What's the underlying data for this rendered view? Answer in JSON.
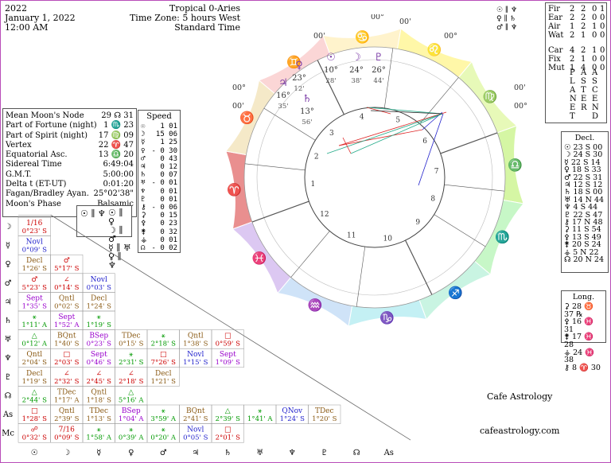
{
  "header": {
    "year": "2022",
    "date": "January 1, 2022",
    "time": "12:00 AM",
    "zodiac": "Tropical 0-Aries",
    "timezone": "Time Zone: 5 hours West",
    "standard": "Standard Time"
  },
  "points": [
    {
      "k": "Mean Moon's Node",
      "v": "29 ☊ 31"
    },
    {
      "k": "Part of Fortune (night)",
      "v": "1 ♏ 23"
    },
    {
      "k": "Part of Spirit (night)",
      "v": "17 ♍ 09"
    },
    {
      "k": "Vertex",
      "v": "22 ♈ 47"
    },
    {
      "k": "Equatorial Asc.",
      "v": "13 ♎ 20"
    },
    {
      "k": "Sidereal Time",
      "v": "6:49:04"
    },
    {
      "k": "G.M.T.",
      "v": "5:00:00"
    },
    {
      "k": "Delta t (ET-UT)",
      "v": "0:01:20"
    },
    {
      "k": "Fagan/Bradley Ayan.",
      "v": "25°02'38\""
    },
    {
      "k": "Moon's Phase",
      "v": "Balsamic"
    }
  ],
  "speed": {
    "title": "Speed",
    "rows": [
      {
        "g": "☉",
        "v": "1 01"
      },
      {
        "g": "☽",
        "v": "15 06"
      },
      {
        "g": "☿",
        "v": "1 25"
      },
      {
        "g": "♀",
        "v": "- 0 30"
      },
      {
        "g": "♂",
        "v": "0 43"
      },
      {
        "g": "♃",
        "v": "0 12"
      },
      {
        "g": "♄",
        "v": "0 07"
      },
      {
        "g": "♅",
        "v": "- 0 01"
      },
      {
        "g": "♆",
        "v": "0 01"
      },
      {
        "g": "♇",
        "v": "0 01"
      },
      {
        "g": "⚷",
        "v": "- 0 06"
      },
      {
        "g": "⚳",
        "v": "0 15"
      },
      {
        "g": "⚴",
        "v": "0 23"
      },
      {
        "g": "⚵",
        "v": "0 32"
      },
      {
        "g": "⚶",
        "v": "0 01"
      },
      {
        "g": "☊",
        "v": "- 0 02"
      }
    ]
  },
  "elements": {
    "labels": [
      "Fir",
      "Ear",
      "Air",
      "Wat",
      "Car",
      "Fix",
      "Mut"
    ],
    "col1": [
      "2",
      "2",
      "1",
      "2",
      "4",
      "2",
      "1"
    ],
    "col2": [
      "2",
      "2",
      "2",
      "1",
      "2",
      "1",
      "4"
    ],
    "col3": [
      "0",
      "0",
      "1",
      "0",
      "1",
      "0",
      "0"
    ],
    "col4": [
      "1",
      "0",
      "0",
      "0",
      "0",
      "0",
      "0"
    ],
    "vert1": [
      "P",
      "L",
      "A",
      "N",
      "E",
      "T"
    ],
    "vert2": [
      "A",
      "S",
      "T",
      "E",
      "R"
    ],
    "vert3": [
      "A",
      "S",
      "C",
      "E",
      "N",
      "D"
    ]
  },
  "top_parallels": [
    "☉ ∥ ♆",
    "♀ ∥ ♄",
    "♂ ∥ ♆"
  ],
  "mid_parallels": [
    "☉ ∥ ♀",
    "☽ ∥ ♂",
    "☿ ∥ ♅",
    "♀ ∥ ♆"
  ],
  "moon_parallel": "☉ ∥ ♆",
  "declinations": {
    "title": "Decl.",
    "rows": [
      "☉ 23 S 00",
      "☽ 24 S 30",
      "☿ 22 S 14",
      "♀ 18 S 33",
      "♂ 22 S 31",
      "♃ 12 S 12",
      "♄ 18 S 00",
      "♅ 14 N 44",
      "♆ 4 S 44",
      "♇ 22 S 47",
      "⚷ 17 N 48",
      "⚳ 11 S 54",
      "⚴ 13 S 49",
      "⚵ 20 S 24",
      "⚶ 5 N 22",
      "☊ 20 N 24"
    ]
  },
  "longitudes": {
    "title": "Long.",
    "rows": [
      "⚳ 28 ♉ 37 ℞",
      "⚴ 16 ♓ 31",
      "⚵ 17 ♓ 28",
      "⚶ 24 ♓ 38",
      "⚷ 8 ♈ 30"
    ]
  },
  "credits": {
    "name": "Cafe Astrology",
    "site": "cafeastrology.com"
  },
  "colors": {
    "aries": "#e6a0a0",
    "taurus": "#e0d2b4",
    "gemini": "#ffdcdc",
    "cancer": "#fff6d6"
  },
  "wheel": {
    "angles": [
      "9",
      "10",
      "11",
      "12",
      "1",
      "2",
      "3",
      "4",
      "5",
      "6",
      "7",
      "8"
    ],
    "outer_degrees": [
      "00°",
      "00'",
      "00'",
      "00°",
      "00°",
      "00'",
      "00'",
      "00°"
    ],
    "planets": [
      {
        "glyph": "☉",
        "deg": "10°",
        "min": "28'"
      },
      {
        "glyph": "☽",
        "deg": "24°",
        "min": "38'"
      },
      {
        "glyph": "♇",
        "deg": "26°",
        "min": "44'"
      },
      {
        "glyph": "♀",
        "deg": "23°",
        "min": "12'"
      },
      {
        "glyph": "♃",
        "deg": "16°",
        "min": "35'"
      },
      {
        "glyph": "♄",
        "deg": "13°",
        "min": "56'"
      }
    ]
  },
  "aspect_grid": {
    "row_labels": [
      "☽",
      "☿",
      "♀",
      "♂",
      "♃",
      "♄",
      "♅",
      "♆",
      "♇",
      "☊",
      "As",
      "Mc"
    ],
    "col_labels": [
      "☉",
      "☽",
      "☿",
      "♀",
      "♂",
      "♃",
      "♄",
      "♅",
      "♆",
      "♇",
      "☊",
      "As"
    ],
    "cells": [
      [
        "1/16\n0°23' S"
      ],
      [
        "Novl\n0°09' S"
      ],
      [
        "Decl\n1°26' S",
        "♂\n5°17' S"
      ],
      [
        "♂\n5°23' S",
        "∠\n0°14' S",
        "Novl\n0°03' S"
      ],
      [
        "Sept\n1°35' S",
        "Qntl\n0°02' S",
        "Decl\n1°24' S"
      ],
      [
        "⚹\n1°11' A",
        "Sept\n1°52' A",
        "⚹\n1°19' S"
      ],
      [
        "△\n0°12' A",
        "BQnt\n1°40' S",
        "BSep\n0°23' S",
        "TDec\n0°15' S",
        "⚹\n2°18' S",
        "Qntl\n1°38' S",
        "□\n0°59' S"
      ],
      [
        "Qntl\n2°04' S",
        "□\n2°03' S",
        "Sept\n0°46' S",
        "⚹\n2°31' S",
        "□\n7°26' S",
        "Novl\n1°15' S",
        "Sept\n1°09' S"
      ],
      [
        "Decl\n1°19' S",
        "∠\n2°32' S",
        "∠\n2°45' S",
        "∠\n2°18' S",
        "Decl\n1°21' S"
      ],
      [
        "△\n2°44' S",
        "TDec\n1°17' A",
        "Qntl\n1°18' S",
        "△\n5°16' A"
      ],
      [
        "□\n1°28' S",
        "Qntl\n2°39' S",
        "TDec\n1°13' S",
        "BSep\n1°04' A",
        "⚹\n3°59' A",
        "BQnt\n2°41' S",
        "△\n2°39' S",
        "⚹\n1°41' A",
        "QNov\n1°24' S",
        "TDec\n1°20' S"
      ],
      [
        "☍\n0°32' S",
        "7/16\n0°09' S",
        "⚹\n1°58' A",
        "⚹\n0°39' A",
        "⚹\n0°20' A",
        "Novl\n0°05' S",
        "□\n2°01' S"
      ]
    ]
  }
}
